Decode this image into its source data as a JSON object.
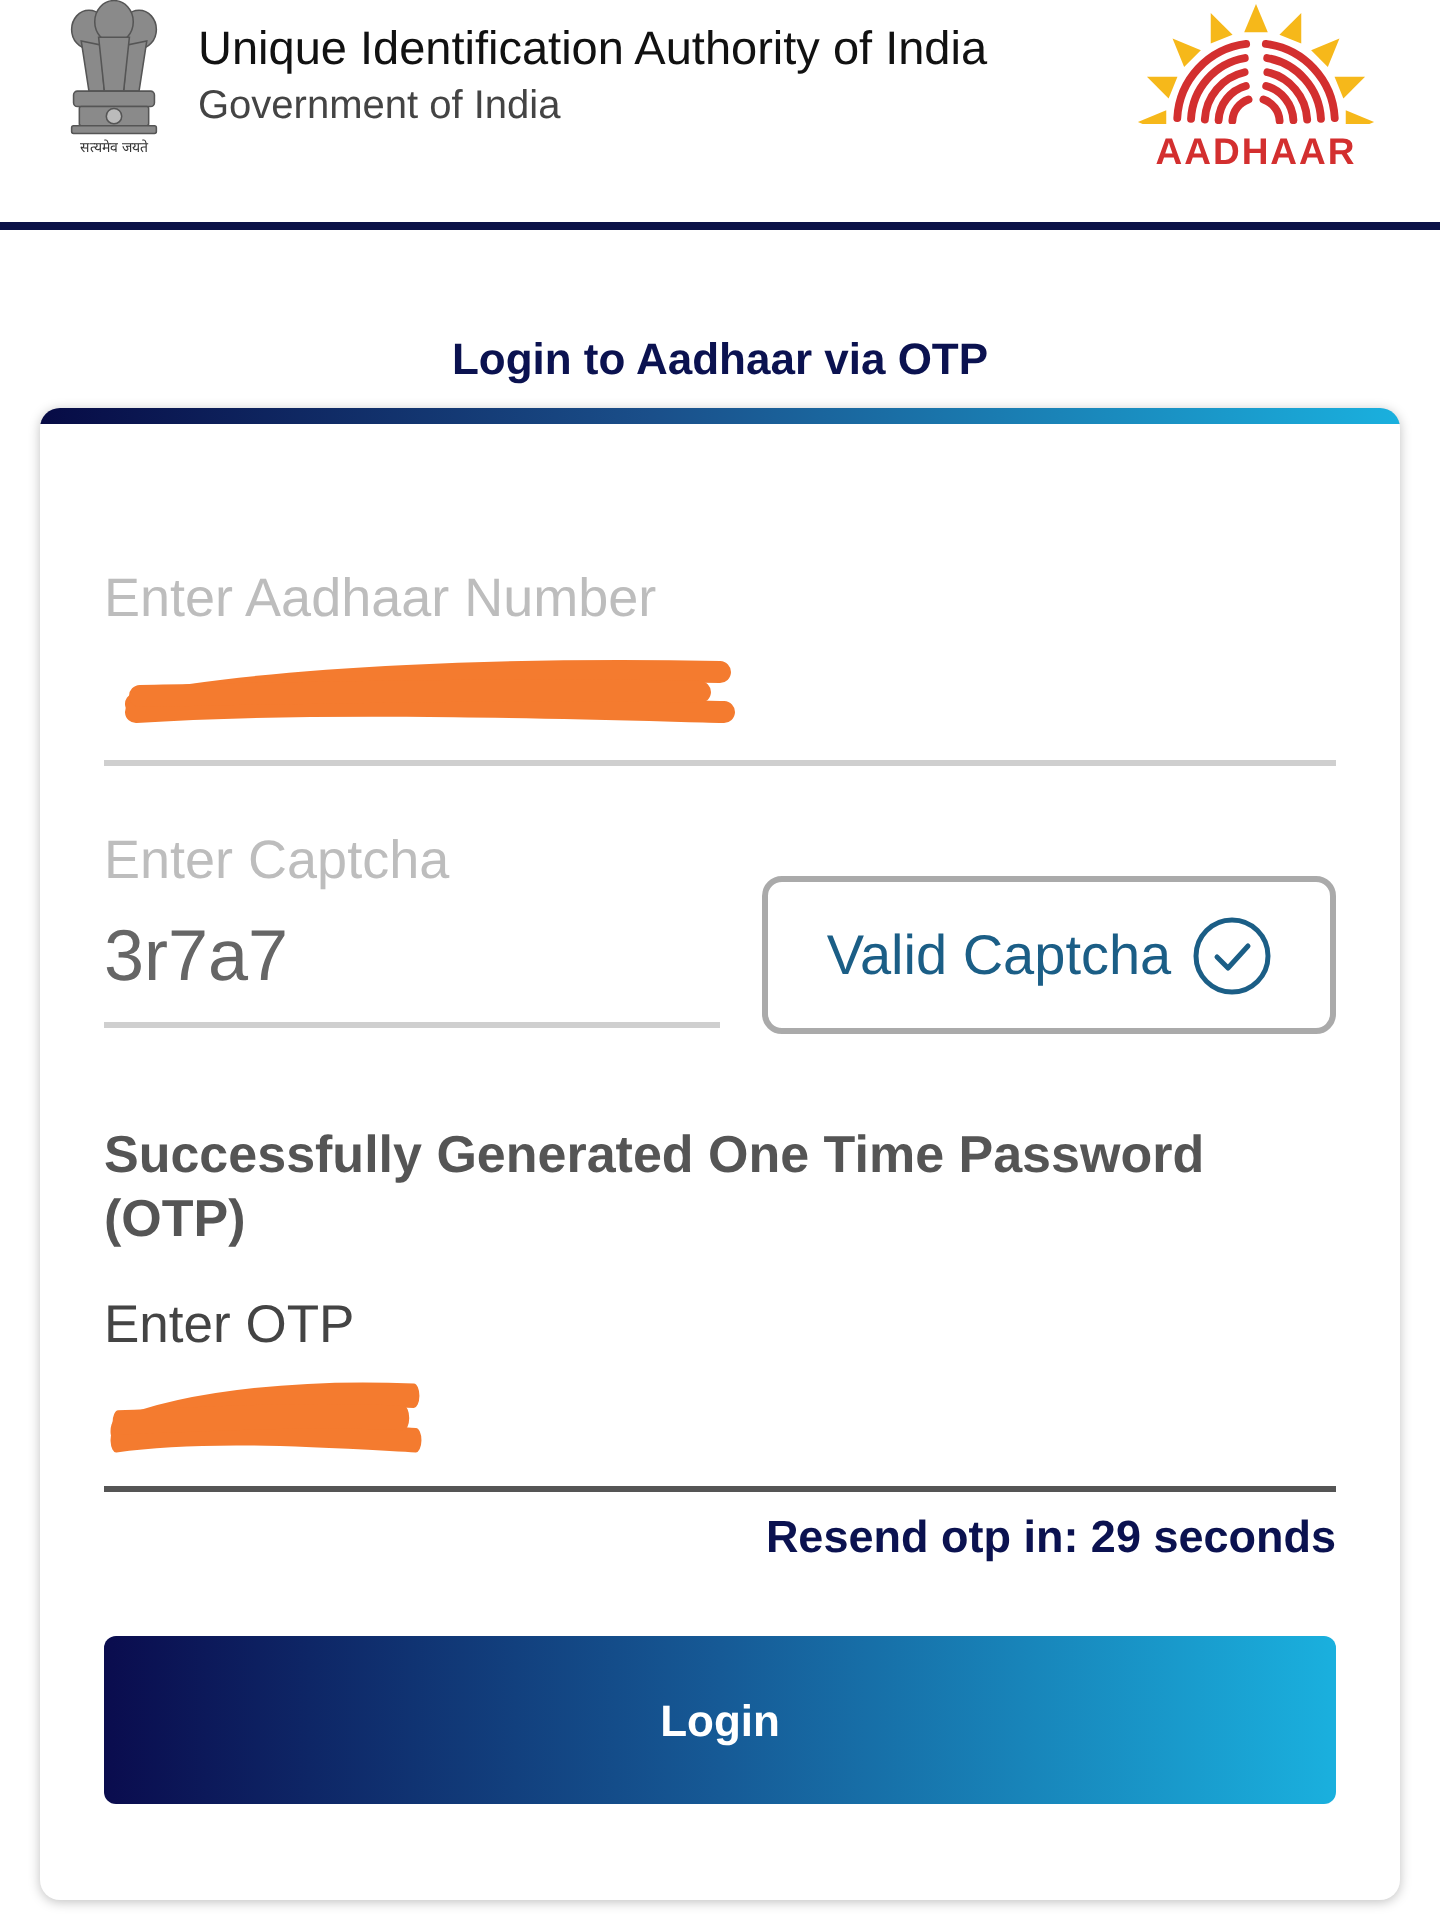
{
  "header": {
    "emblem_motto": "सत्यमेव जयते",
    "title": "Unique Identification Authority of India",
    "subtitle": "Government of India",
    "logo_text": "AADHAAR"
  },
  "heading": "Login to Aadhaar via OTP",
  "aadhaar_field": {
    "label": "Enter Aadhaar Number",
    "focused": false,
    "redacted": true
  },
  "captcha": {
    "field": {
      "label": "Enter Captcha",
      "value": "3r7a7",
      "focused": false,
      "redacted": false
    },
    "status": {
      "text": "Valid Captcha",
      "valid": true
    }
  },
  "otp_message": "Successfully Generated One Time Password (OTP)",
  "otp_field": {
    "label": "Enter OTP",
    "focused": true,
    "redacted": true
  },
  "resend_timer": "Resend otp in: 29 seconds",
  "login_button": "Login"
}
